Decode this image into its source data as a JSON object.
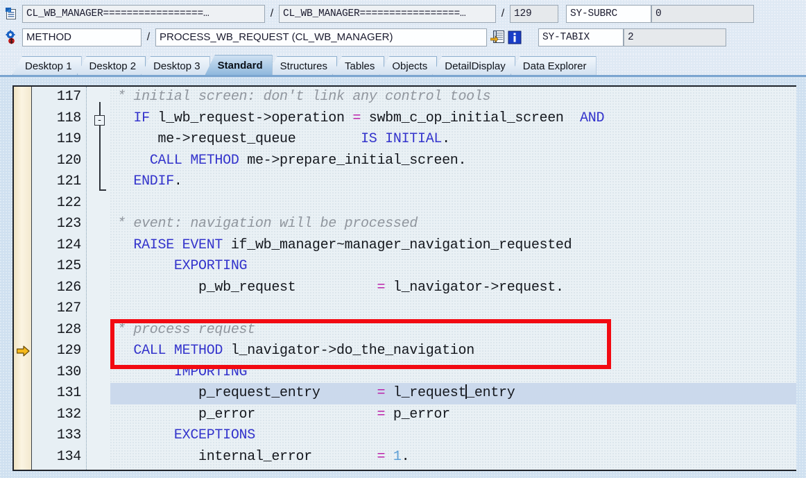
{
  "header": {
    "program_icon": "abap-program-icon",
    "debug_icon": "debugger-gear-bug-icon",
    "row1": {
      "class_main": "CL_WB_MANAGER=================…",
      "class_impl": "CL_WB_MANAGER=================…",
      "line_number": "129",
      "sep1": "/",
      "sep2": "/",
      "sy_subrc_label": "SY-SUBRC",
      "sy_subrc_value": "0"
    },
    "row2": {
      "event_type": "METHOD",
      "sep1": "/",
      "method_name": "PROCESS_WB_REQUEST (CL_WB_MANAGER)",
      "goto_icon": "goto-source-icon",
      "info_icon": "info-icon",
      "sy_tabix_label": "SY-TABIX",
      "sy_tabix_value": "2"
    }
  },
  "tabs": [
    {
      "label": "Desktop 1",
      "active": false
    },
    {
      "label": "Desktop 2",
      "active": false
    },
    {
      "label": "Desktop 3",
      "active": false
    },
    {
      "label": "Standard",
      "active": true
    },
    {
      "label": "Structures",
      "active": false
    },
    {
      "label": "Tables",
      "active": false
    },
    {
      "label": "Objects",
      "active": false
    },
    {
      "label": "DetailDisplay",
      "active": false
    },
    {
      "label": "Data Explorer",
      "active": false
    }
  ],
  "editor": {
    "current_line_marker": "execution-pointer-arrow",
    "current_line": "129",
    "fold_marker": "-",
    "line_numbers": [
      "117",
      "118",
      "119",
      "120",
      "121",
      "122",
      "123",
      "124",
      "125",
      "126",
      "127",
      "128",
      "129",
      "130",
      "131",
      "132",
      "133",
      "134"
    ],
    "lines": [
      {
        "n": "117",
        "text": "* initial screen: don't link any control tools"
      },
      {
        "n": "118",
        "text": "  IF l_wb_request->operation = swbm_c_op_initial_screen  AND"
      },
      {
        "n": "119",
        "text": "     me->request_queue        IS INITIAL."
      },
      {
        "n": "120",
        "text": "    CALL METHOD me->prepare_initial_screen."
      },
      {
        "n": "121",
        "text": "  ENDIF."
      },
      {
        "n": "122",
        "text": ""
      },
      {
        "n": "123",
        "text": "* event: navigation will be processed"
      },
      {
        "n": "124",
        "text": "  RAISE EVENT if_wb_manager~manager_navigation_requested"
      },
      {
        "n": "125",
        "text": "       EXPORTING"
      },
      {
        "n": "126",
        "text": "          p_wb_request          = l_navigator->request."
      },
      {
        "n": "127",
        "text": ""
      },
      {
        "n": "128",
        "text": "* process request"
      },
      {
        "n": "129",
        "text": "  CALL METHOD l_navigator->do_the_navigation"
      },
      {
        "n": "130",
        "text": "       IMPORTING"
      },
      {
        "n": "131",
        "text": "          p_request_entry       = l_request_entry"
      },
      {
        "n": "132",
        "text": "          p_error               = p_error"
      },
      {
        "n": "133",
        "text": "       EXCEPTIONS"
      },
      {
        "n": "134",
        "text": "          internal_error        = 1."
      }
    ],
    "selected_line": "131",
    "highlight_box": {
      "name": "red-annotation-box",
      "color": "#f20a12",
      "covers_lines": [
        "128",
        "129"
      ]
    }
  }
}
